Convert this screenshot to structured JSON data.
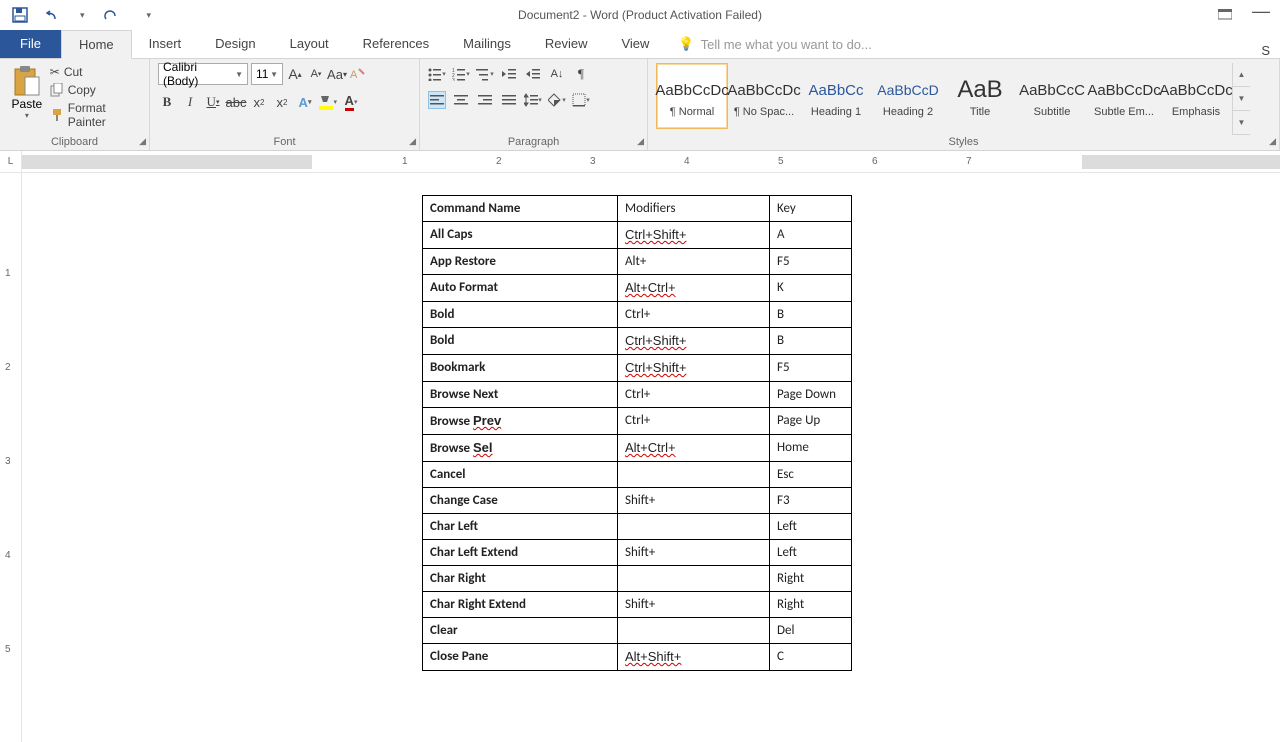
{
  "titlebar": {
    "title": "Document2 - Word (Product Activation Failed)"
  },
  "tabs": {
    "file": "File",
    "items": [
      "Home",
      "Insert",
      "Design",
      "Layout",
      "References",
      "Mailings",
      "Review",
      "View"
    ],
    "tellme_placeholder": "Tell me what you want to do...",
    "share": "S"
  },
  "clipboard": {
    "paste": "Paste",
    "cut": "Cut",
    "copy": "Copy",
    "format_painter": "Format Painter",
    "label": "Clipboard"
  },
  "font": {
    "family": "Calibri (Body)",
    "size": "11",
    "label": "Font"
  },
  "paragraph": {
    "label": "Paragraph"
  },
  "styles": {
    "label": "Styles",
    "items": [
      {
        "preview": "AaBbCcDc",
        "name": "¶ Normal",
        "cls": ""
      },
      {
        "preview": "AaBbCcDc",
        "name": "¶ No Spac...",
        "cls": ""
      },
      {
        "preview": "AaBbCc",
        "name": "Heading 1",
        "cls": "h1"
      },
      {
        "preview": "AaBbCcD",
        "name": "Heading 2",
        "cls": "h2"
      },
      {
        "preview": "AaB",
        "name": "Title",
        "cls": "title"
      },
      {
        "preview": "AaBbCcC",
        "name": "Subtitle",
        "cls": ""
      },
      {
        "preview": "AaBbCcDc",
        "name": "Subtle Em...",
        "cls": ""
      },
      {
        "preview": "AaBbCcDc",
        "name": "Emphasis",
        "cls": ""
      }
    ]
  },
  "ruler_numbers": [
    "1",
    "2",
    "3",
    "4",
    "5",
    "6",
    "7"
  ],
  "vruler_numbers": [
    "1",
    "2",
    "3",
    "4",
    "5"
  ],
  "table": {
    "headers": [
      "Command Name",
      "Modifiers",
      "Key"
    ],
    "rows": [
      {
        "c1": "All Caps",
        "c2": "Ctrl+Shift+",
        "c2wavy": true,
        "c3": "A"
      },
      {
        "c1": "App Restore",
        "c2": "Alt+",
        "c3": "F5"
      },
      {
        "c1": "Auto Format",
        "c2": "Alt+Ctrl+",
        "c2wavy": true,
        "c3": "K"
      },
      {
        "c1": "Bold",
        "c2": "Ctrl+",
        "c3": "B"
      },
      {
        "c1": "Bold",
        "c2": "Ctrl+Shift+",
        "c2wavy": true,
        "c3": "B"
      },
      {
        "c1": "Bookmark",
        "c2": "Ctrl+Shift+",
        "c2wavy": true,
        "c3": "F5"
      },
      {
        "c1": "Browse Next",
        "c2": "Ctrl+",
        "c3": "Page Down"
      },
      {
        "c1": "Browse Prev",
        "c1wavy": "Prev",
        "c2": "Ctrl+",
        "c3": "Page Up"
      },
      {
        "c1": "Browse Sel",
        "c1wavy": "Sel",
        "c2": "Alt+Ctrl+",
        "c2wavy": true,
        "c3": "Home"
      },
      {
        "c1": "Cancel",
        "c2": "",
        "c3": "Esc"
      },
      {
        "c1": "Change Case",
        "c2": "Shift+",
        "c3": "F3"
      },
      {
        "c1": "Char Left",
        "c2": "",
        "c3": "Left"
      },
      {
        "c1": "Char Left Extend",
        "c2": "Shift+",
        "c3": "Left"
      },
      {
        "c1": "Char Right",
        "c2": "",
        "c3": "Right"
      },
      {
        "c1": "Char Right Extend",
        "c2": "Shift+",
        "c3": "Right"
      },
      {
        "c1": "Clear",
        "c2": "",
        "c3": "Del"
      },
      {
        "c1": "Close Pane",
        "c2": "Alt+Shift+",
        "c2wavy": true,
        "c3": "C"
      }
    ]
  }
}
